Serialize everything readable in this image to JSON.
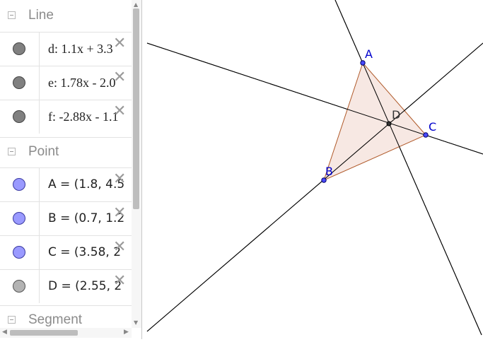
{
  "algebra": {
    "groups": [
      {
        "label": "Line",
        "items": [
          {
            "text": "d: 1.1x + 3.3",
            "marble": "#808080"
          },
          {
            "text": "e: 1.78x - 2.0",
            "marble": "#808080"
          },
          {
            "text": "f: -2.88x - 1.1",
            "marble": "#808080"
          }
        ]
      },
      {
        "label": "Point",
        "items": [
          {
            "text": "A = (1.8, 4.5",
            "marble": "#9a9aff"
          },
          {
            "text": "B = (0.7, 1.2",
            "marble": "#9a9aff"
          },
          {
            "text": "C = (3.58, 2",
            "marble": "#9a9aff"
          },
          {
            "text": "D = (2.55, 2",
            "marble": "#b3b3b3"
          }
        ]
      },
      {
        "label": "Segment",
        "items": []
      }
    ],
    "delete_glyph": "✕"
  },
  "graphics": {
    "points": {
      "A": {
        "label": "A",
        "color": "#0000cc"
      },
      "B": {
        "label": "B",
        "color": "#0000cc"
      },
      "C": {
        "label": "C",
        "color": "#0000cc"
      },
      "D": {
        "label": "D",
        "color": "#333333"
      }
    },
    "triangle_fill": "#f6e4de",
    "triangle_stroke": "#b05a2a",
    "line_color": "#000000"
  }
}
